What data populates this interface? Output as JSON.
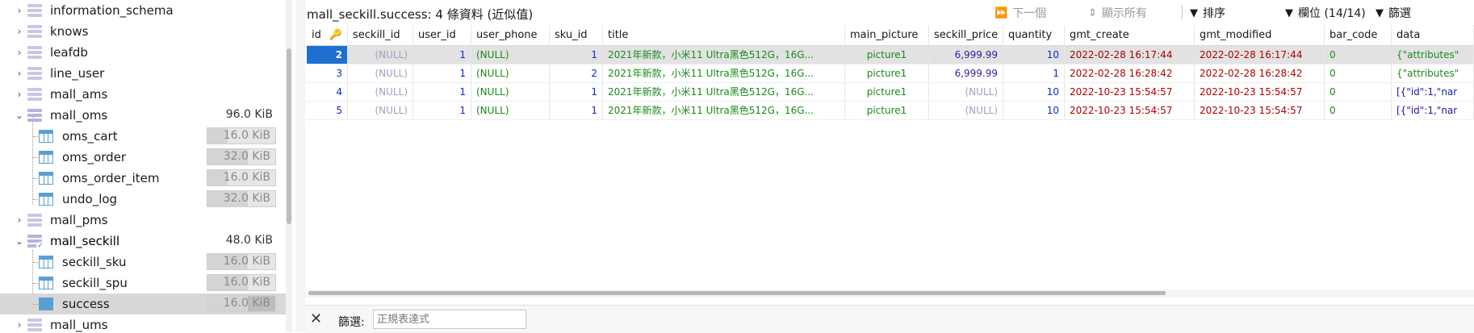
{
  "sidebar": {
    "nodes": [
      {
        "label": "information_schema",
        "type": "db",
        "size": ""
      },
      {
        "label": "knows",
        "type": "db",
        "size": ""
      },
      {
        "label": "leafdb",
        "type": "db",
        "size": ""
      },
      {
        "label": "line_user",
        "type": "db",
        "size": ""
      },
      {
        "label": "mall_ams",
        "type": "db",
        "size": ""
      },
      {
        "label": "mall_oms",
        "type": "db",
        "size": "96.0 KiB"
      },
      {
        "label": "oms_cart",
        "type": "table",
        "size": "16.0 KiB"
      },
      {
        "label": "oms_order",
        "type": "table",
        "size": "32.0 KiB"
      },
      {
        "label": "oms_order_item",
        "type": "table",
        "size": "16.0 KiB"
      },
      {
        "label": "undo_log",
        "type": "table",
        "size": "32.0 KiB"
      },
      {
        "label": "mall_pms",
        "type": "db",
        "size": ""
      },
      {
        "label": "mall_seckill",
        "type": "db",
        "size": "48.0 KiB"
      },
      {
        "label": "seckill_sku",
        "type": "table",
        "size": "16.0 KiB"
      },
      {
        "label": "seckill_spu",
        "type": "table",
        "size": "16.0 KiB"
      },
      {
        "label": "success",
        "type": "table",
        "size": "16.0 KiB"
      },
      {
        "label": "mall_ums",
        "type": "db",
        "size": ""
      }
    ]
  },
  "toolbar": {
    "title": "mall_seckill.success: 4 條資料 (近似值)",
    "next_label": "下一個",
    "show_all_label": "顯示所有",
    "sort_label": "排序",
    "columns_label": "欄位 (14/14)",
    "filter_label": "篩選"
  },
  "grid": {
    "columns": [
      "id",
      "seckill_id",
      "user_id",
      "user_phone",
      "sku_id",
      "title",
      "main_picture",
      "seckill_price",
      "quantity",
      "gmt_create",
      "gmt_modified",
      "bar_code",
      "data"
    ],
    "rows": [
      [
        "2",
        "(NULL)",
        "1",
        "(NULL)",
        "1",
        "2021年新款，小米11 Ultra黑色512G，16G...",
        "picture1",
        "6,999.99",
        "10",
        "2022-02-28 16:17:44",
        "2022-02-28 16:17:44",
        "0",
        "{\"attributes\""
      ],
      [
        "3",
        "(NULL)",
        "1",
        "(NULL)",
        "2",
        "2021年新款，小米11 Ultra黑色512G，16G...",
        "picture1",
        "6,999.99",
        "1",
        "2022-02-28 16:28:42",
        "2022-02-28 16:28:42",
        "0",
        "{\"attributes\""
      ],
      [
        "4",
        "(NULL)",
        "1",
        "(NULL)",
        "1",
        "2021年新款，小米11 Ultra黑色512G，16G...",
        "picture1",
        "(NULL)",
        "10",
        "2022-10-23 15:54:57",
        "2022-10-23 15:54:57",
        "0",
        "[{\"id\":1,\"nar"
      ],
      [
        "5",
        "(NULL)",
        "1",
        "(NULL)",
        "1",
        "2021年新款，小米11 Ultra黑色512G，16G...",
        "picture1",
        "(NULL)",
        "10",
        "2022-10-23 15:54:57",
        "2022-10-23 15:54:57",
        "0",
        "[{\"id\":1,\"nar"
      ]
    ]
  },
  "filterbar": {
    "label": "篩選:",
    "placeholder": "正規表達式"
  }
}
